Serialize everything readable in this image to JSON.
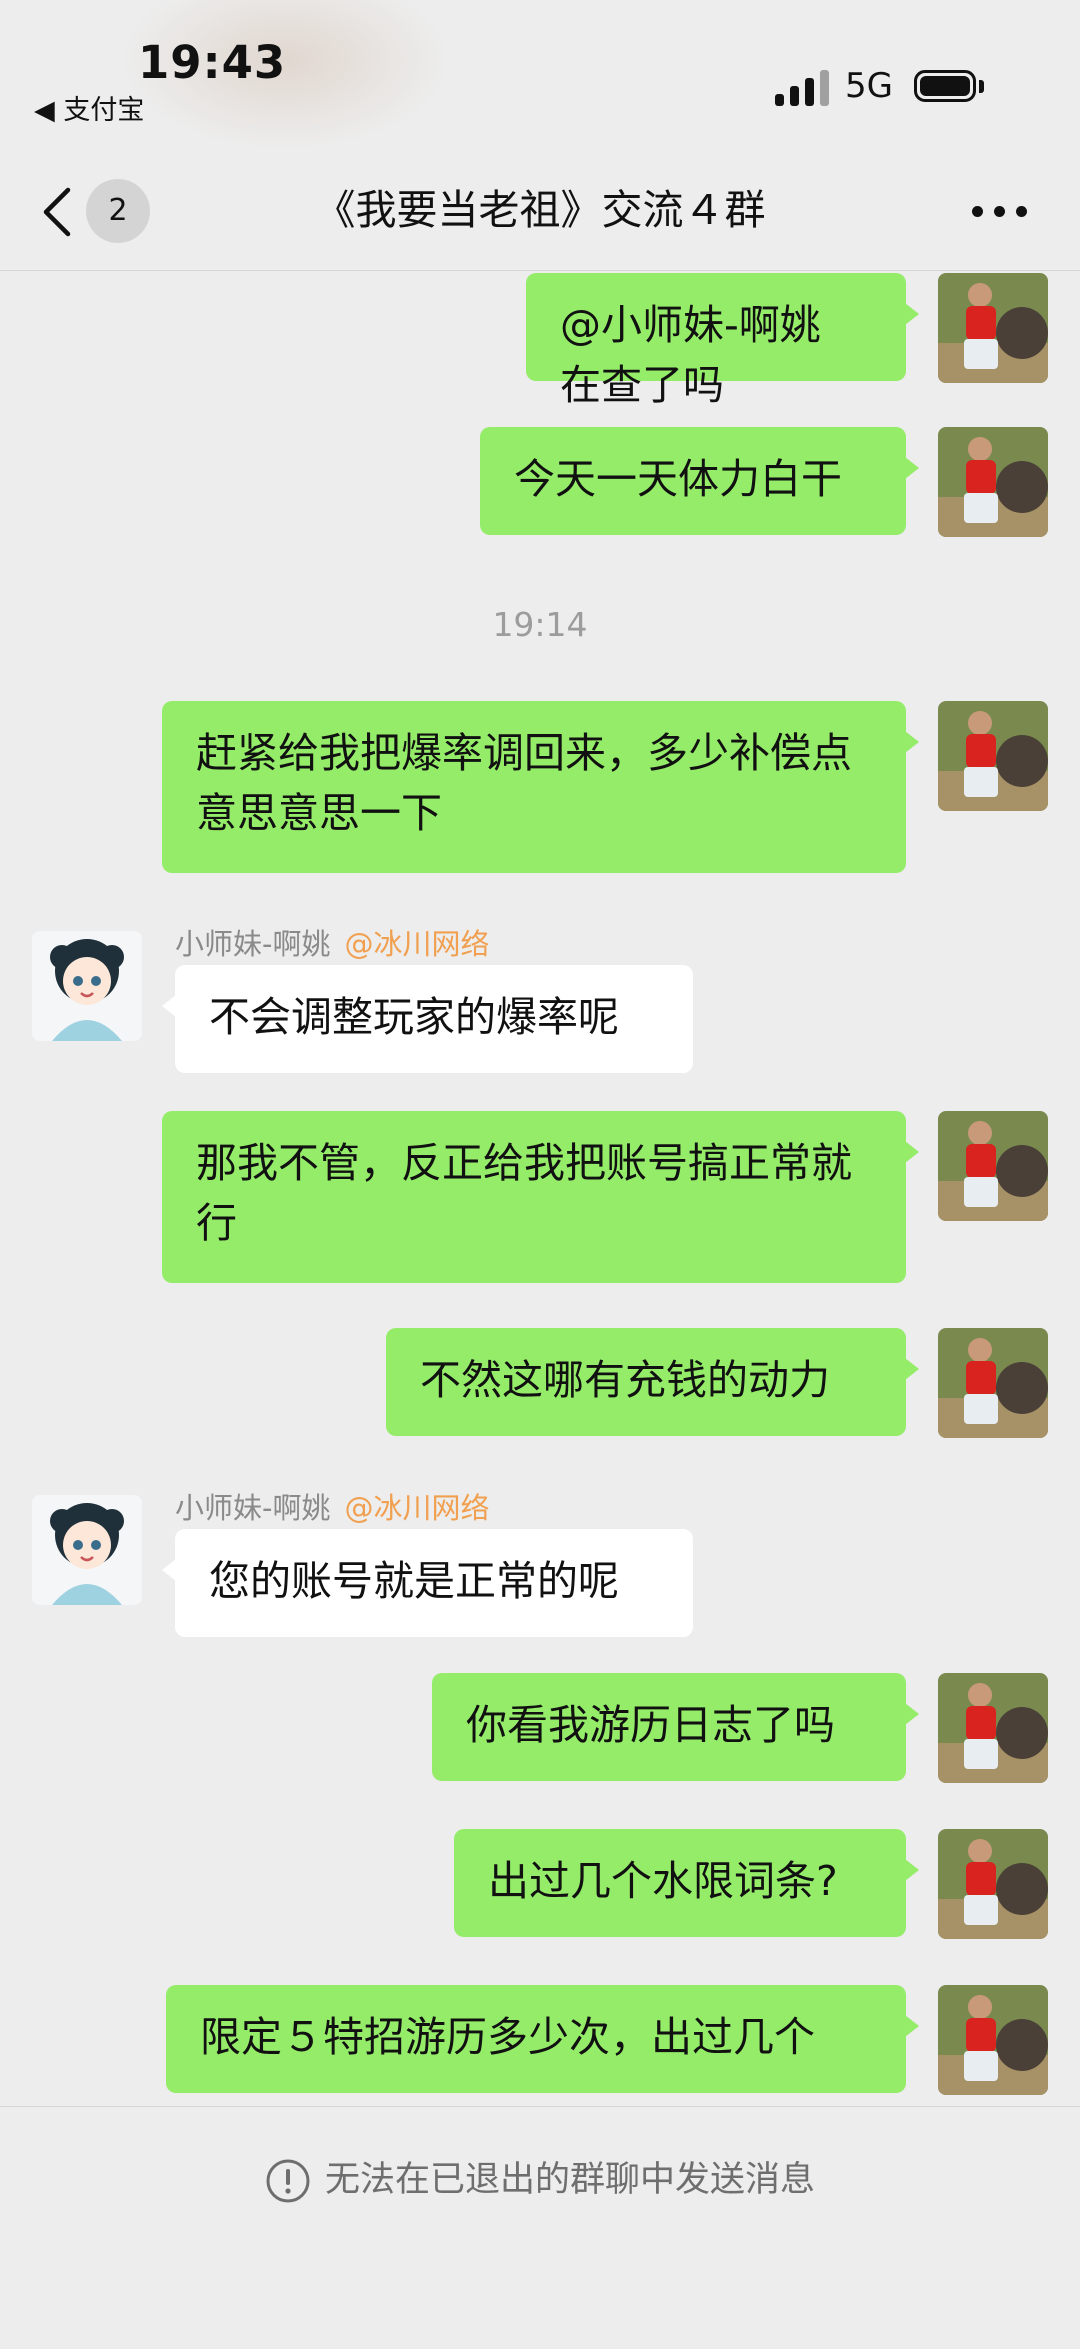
{
  "status_bar": {
    "time": "19:43",
    "back_app": "◀ 支付宝",
    "network": "5G"
  },
  "nav": {
    "unread_count": "2",
    "title": "《我要当老祖》交流４群"
  },
  "messages": [
    {
      "type": "sent",
      "text": "@小师妹-啊姚 在查了吗"
    },
    {
      "type": "sent",
      "text": "今天一天体力白干"
    },
    {
      "type": "time",
      "text": "19:14"
    },
    {
      "type": "sent",
      "text": "赶紧给我把爆率调回来，多少补偿点意思意思一下"
    },
    {
      "type": "received",
      "sender": "小师妹-啊姚",
      "tag": "@冰川网络",
      "text": "不会调整玩家的爆率呢"
    },
    {
      "type": "sent",
      "text": "那我不管，反正给我把账号搞正常就行"
    },
    {
      "type": "sent",
      "text": "不然这哪有充钱的动力"
    },
    {
      "type": "received",
      "sender": "小师妹-啊姚",
      "tag": "@冰川网络",
      "text": "您的账号就是正常的呢"
    },
    {
      "type": "sent",
      "text": "你看我游历日志了吗"
    },
    {
      "type": "sent",
      "text": "出过几个水限词条?"
    },
    {
      "type": "sent",
      "text": "限定５特招游历多少次，出过几个"
    }
  ],
  "footer": {
    "notice": "无法在已退出的群聊中发送消息"
  },
  "colors": {
    "sent_bubble": "#95ec69",
    "received_bubble": "#ffffff",
    "background": "#ededed",
    "mention": "#f0a050"
  },
  "icons": [
    "chevron-left-icon",
    "more-icon",
    "signal-icon",
    "battery-icon",
    "info-icon"
  ]
}
